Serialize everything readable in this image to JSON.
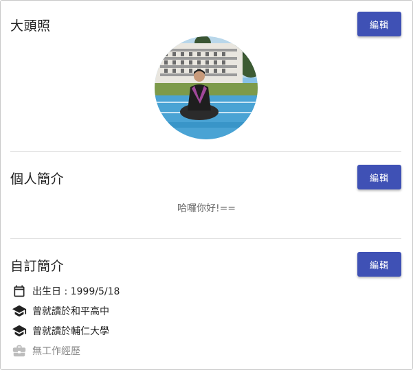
{
  "profile_photo": {
    "title": "大頭照",
    "edit_label": "編輯"
  },
  "bio": {
    "title": "個人簡介",
    "edit_label": "編輯",
    "text": "哈囉你好!=="
  },
  "custom_profile": {
    "title": "自訂簡介",
    "edit_label": "編輯",
    "birthday": "出生日 : 1999/5/18",
    "school_1": "曾就讀於和平高中",
    "school_2": "曾就讀於輔仁大學",
    "work": "無工作經歷"
  },
  "colors": {
    "accent": "#3f51b5",
    "muted_icon": "#bdbdbd"
  },
  "icons": [
    "calendar-icon",
    "graduation-cap-icon",
    "briefcase-icon"
  ]
}
